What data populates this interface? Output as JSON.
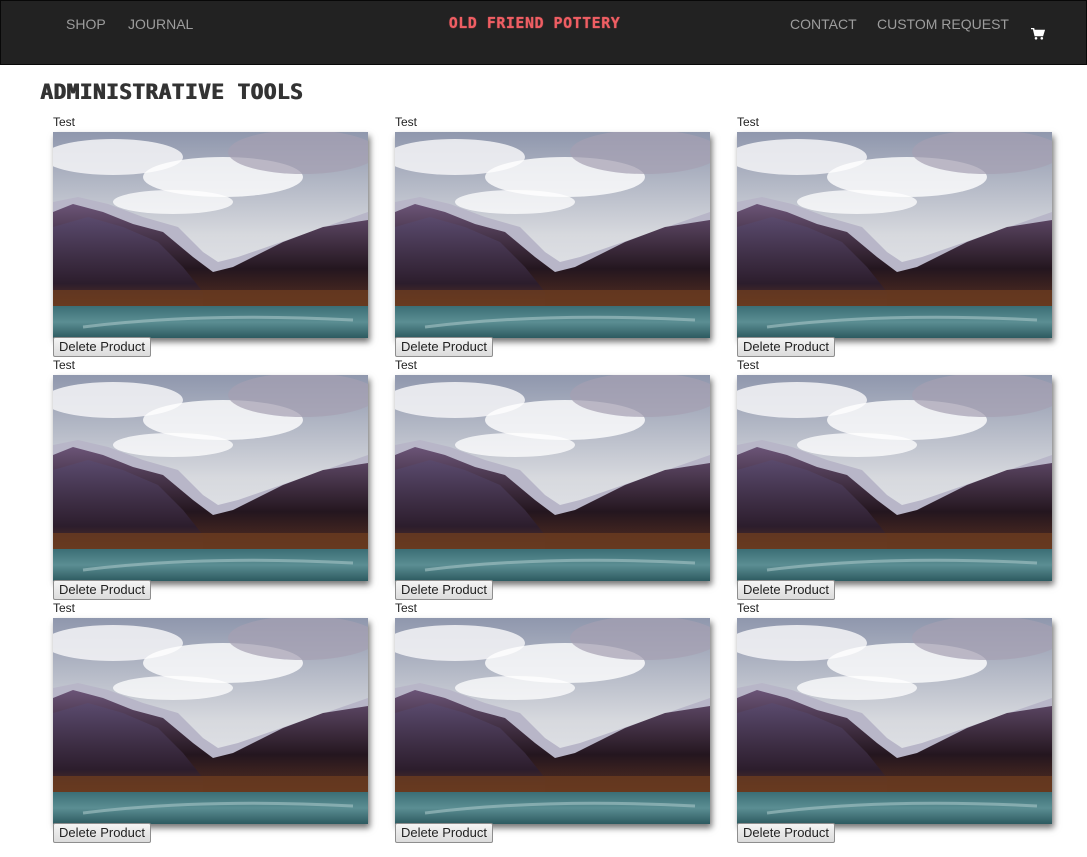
{
  "nav": {
    "left_links": [
      "SHOP",
      "JOURNAL"
    ],
    "brand": "OLD FRIEND POTTERY",
    "right_links": [
      "CONTACT",
      "CUSTOM REQUEST"
    ],
    "cart_icon": "shopping-cart-icon"
  },
  "page": {
    "title": "ADMINISTRATIVE TOOLS"
  },
  "products": [
    {
      "title": "Test",
      "delete_label": "Delete Product"
    },
    {
      "title": "Test",
      "delete_label": "Delete Product"
    },
    {
      "title": "Test",
      "delete_label": "Delete Product"
    },
    {
      "title": "Test",
      "delete_label": "Delete Product"
    },
    {
      "title": "Test",
      "delete_label": "Delete Product"
    },
    {
      "title": "Test",
      "delete_label": "Delete Product"
    },
    {
      "title": "Test",
      "delete_label": "Delete Product"
    },
    {
      "title": "Test",
      "delete_label": "Delete Product"
    },
    {
      "title": "Test",
      "delete_label": "Delete Product"
    }
  ],
  "colors": {
    "navbar_bg": "#222222",
    "nav_link": "#9d9d9d",
    "brand": "#ef5e63"
  }
}
